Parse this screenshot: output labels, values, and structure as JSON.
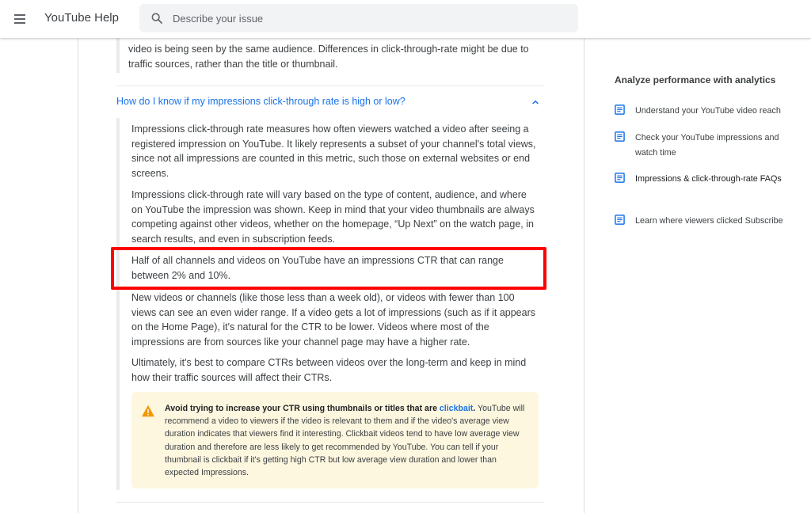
{
  "header": {
    "app_title": "YouTube Help",
    "search_placeholder": "Describe your issue",
    "search_value": ""
  },
  "main": {
    "prev_answer_text": "video is being seen by the same audience. Differences in click-through-rate might be due to traffic sources, rather than the title or thumbnail.",
    "faq_question": "How do I know if my impressions click-through rate is high or low?",
    "paragraphs": [
      "Impressions click-through rate measures how often viewers watched a video after seeing a registered impression on YouTube. It likely represents a subset of your channel's total views, since not all impressions are counted in this metric, such those on external websites or end screens.",
      "Impressions click-through rate will vary based on the type of content, audience, and where on YouTube the impression was shown. Keep in mind that your video thumbnails are always competing against other videos, whether on the homepage, “Up Next” on the watch page, in search results, and even in subscription feeds.",
      "Half of all channels and videos on YouTube have an impressions CTR that can range between 2% and 10%.",
      "New videos or channels (like those less than a week old), or videos with fewer than 100 views can see an even wider range. If a video gets a lot of impressions (such as if it appears on the Home Page), it's natural for the CTR to be lower. Videos where most of the impressions are from sources like your channel page may have a higher rate.",
      "Ultimately, it's best to compare CTRs between videos over the long-term and keep in mind how their traffic sources will affect their CTRs."
    ],
    "callout": {
      "bold_lead": "Avoid trying to increase your CTR using thumbnails or titles that are ",
      "link_text": "clickbait",
      "bold_end": ".",
      "body": " YouTube will recommend a video to viewers if the video is relevant to them and if the video's average view duration indicates that viewers find it interesting. Clickbait videos tend to have low average view duration and therefore are less likely to get recommended by YouTube. You can tell if your thumbnail is clickbait if it's getting high CTR but low average view duration and lower than expected Impressions."
    }
  },
  "sidebar": {
    "title": "Analyze performance with analytics",
    "items": [
      {
        "label": "Understand your YouTube video reach"
      },
      {
        "label": "Check your YouTube impressions and watch time"
      },
      {
        "label": "Impressions & click-through-rate FAQs"
      },
      {
        "label": "Learn where viewers clicked Subscribe"
      }
    ]
  },
  "colors": {
    "link": "#1a73e8",
    "highlight_border": "#ff0000",
    "callout_bg": "#fef7e0",
    "warning_icon": "#f29900"
  }
}
